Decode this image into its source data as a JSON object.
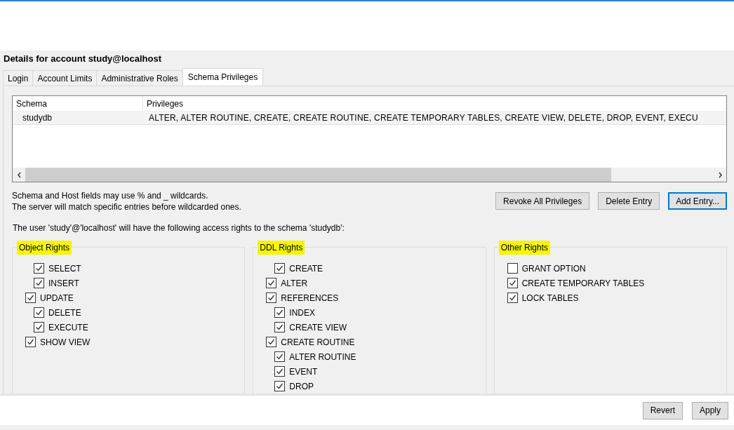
{
  "title": "Details for account study@localhost",
  "tabs": [
    {
      "label": "Login",
      "selected": false
    },
    {
      "label": "Account Limits",
      "selected": false
    },
    {
      "label": "Administrative Roles",
      "selected": false
    },
    {
      "label": "Schema Privileges",
      "selected": true
    }
  ],
  "table": {
    "columns": [
      "Schema",
      "Privileges"
    ],
    "rows": [
      [
        "studydb",
        "ALTER, ALTER ROUTINE, CREATE, CREATE ROUTINE, CREATE TEMPORARY TABLES, CREATE VIEW, DELETE, DROP, EVENT, EXECU"
      ]
    ]
  },
  "info_lines": [
    "Schema and Host fields may use % and _ wildcards.",
    "The server will match specific entries before wildcarded ones."
  ],
  "entry_buttons": [
    {
      "label": "Revoke All Privileges",
      "focused": false
    },
    {
      "label": "Delete Entry",
      "focused": false
    },
    {
      "label": "Add Entry...",
      "focused": true
    }
  ],
  "description": "The user 'study'@'localhost' will have the following access rights to the schema 'studydb':",
  "groups": [
    {
      "title": "Object Rights",
      "highlighted": true,
      "items": [
        {
          "label": "SELECT",
          "checked": true,
          "indented": true
        },
        {
          "label": "INSERT",
          "checked": true,
          "indented": true
        },
        {
          "label": "UPDATE",
          "checked": true,
          "indented": false
        },
        {
          "label": "DELETE",
          "checked": true,
          "indented": true
        },
        {
          "label": "EXECUTE",
          "checked": true,
          "indented": true
        },
        {
          "label": "SHOW VIEW",
          "checked": true,
          "indented": false
        }
      ]
    },
    {
      "title": "DDL Rights",
      "highlighted": true,
      "items": [
        {
          "label": "CREATE",
          "checked": true,
          "indented": true
        },
        {
          "label": "ALTER",
          "checked": true,
          "indented": false
        },
        {
          "label": "REFERENCES",
          "checked": true,
          "indented": false
        },
        {
          "label": "INDEX",
          "checked": true,
          "indented": true
        },
        {
          "label": "CREATE VIEW",
          "checked": true,
          "indented": true
        },
        {
          "label": "CREATE ROUTINE",
          "checked": true,
          "indented": false
        },
        {
          "label": "ALTER ROUTINE",
          "checked": true,
          "indented": true
        },
        {
          "label": "EVENT",
          "checked": true,
          "indented": true
        },
        {
          "label": "DROP",
          "checked": true,
          "indented": true
        }
      ]
    },
    {
      "title": "Other Rights",
      "highlighted": true,
      "items": [
        {
          "label": "GRANT OPTION",
          "checked": false,
          "indented": false
        },
        {
          "label": "CREATE TEMPORARY TABLES",
          "checked": true,
          "indented": false
        },
        {
          "label": "LOCK TABLES",
          "checked": true,
          "indented": false
        }
      ]
    }
  ],
  "footer_buttons": [
    "Revert",
    "Apply"
  ]
}
